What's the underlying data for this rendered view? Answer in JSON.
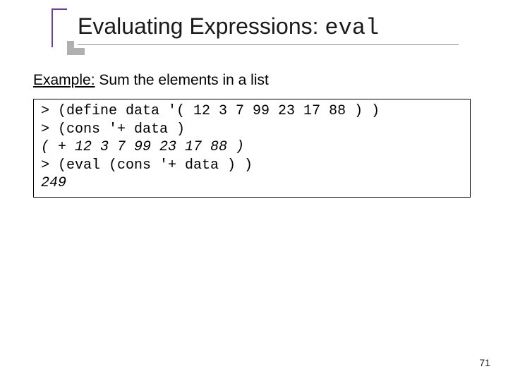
{
  "title": {
    "prefix": "Evaluating Expressions: ",
    "mono": "eval"
  },
  "example": {
    "label": "Example:",
    "text": "  Sum the elements in a list"
  },
  "code": {
    "line1": "> (define data '( 12 3 7 99 23 17 88 ) )",
    "line2": "> (cons '+ data )",
    "line3": "( + 12 3 7 99 23 17 88 )",
    "line4": "> (eval (cons '+ data ) )",
    "line5": "249"
  },
  "page_number": "71"
}
